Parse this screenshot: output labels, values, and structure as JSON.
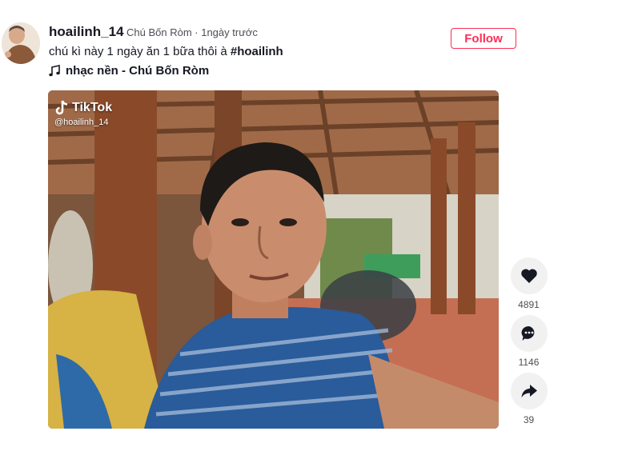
{
  "author": {
    "username": "hoailinh_14",
    "nickname": "Chú Bốn Ròm",
    "separator": " · ",
    "posted": "1ngày trước"
  },
  "follow_label": "Follow",
  "caption": {
    "text": "chú kì này 1 ngày ăn 1 bữa thôi à ",
    "hashtag": "#hoailinh"
  },
  "music": {
    "label": "nhạc nền - Chú Bốn Ròm",
    "icon": "music-note-icon"
  },
  "video": {
    "watermark_brand": "TikTok",
    "watermark_handle": "@hoailinh_14"
  },
  "actions": {
    "likes": "4891",
    "comments": "1146",
    "shares": "39"
  },
  "colors": {
    "accent": "#fe2c55",
    "text": "#161823",
    "muted": "#4d4f57",
    "action_bg": "#f1f1f2"
  }
}
